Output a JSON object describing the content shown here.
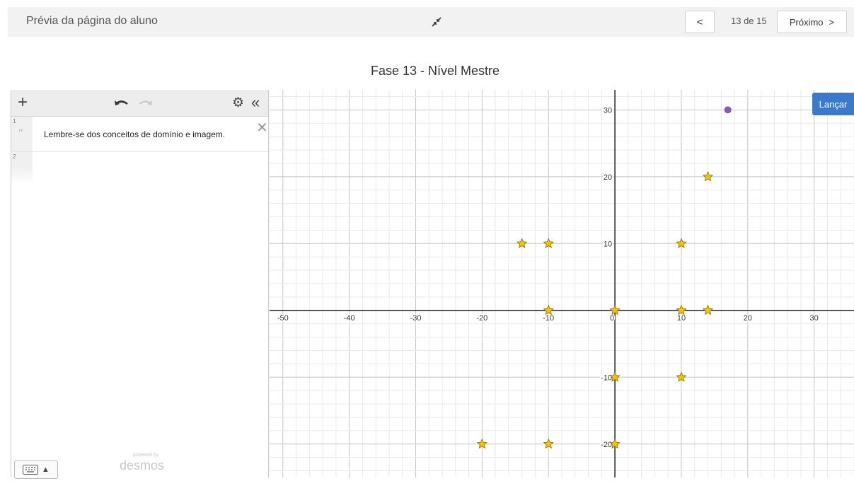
{
  "header": {
    "preview_title": "Prévia da página do aluno",
    "collapse_icon": "collapse-arrows-icon",
    "prev_label": "<",
    "page_counter": "13 de 15",
    "next_label": "Próximo",
    "next_chevron": ">"
  },
  "stage_title": "Fase 13 - Nível Mestre",
  "expressions": {
    "toolbar": {
      "add": "+",
      "settings": "⚙",
      "collapse": "«"
    },
    "rows": [
      {
        "num": "1",
        "quote": "“",
        "text": "Lembre-se dos conceitos de domínio e imagem.",
        "delete": "✕"
      },
      {
        "num": "2"
      }
    ],
    "keyboard_caret": "▲",
    "powered_by": "powered by",
    "logo": "desmos"
  },
  "launch_label": "Lançar",
  "chart_data": {
    "type": "scatter",
    "xlim": [
      -52,
      36
    ],
    "ylim": [
      -25,
      33
    ],
    "x_ticks": [
      -50,
      -40,
      -30,
      -20,
      -10,
      0,
      10,
      20,
      30
    ],
    "x_tick_labels": [
      "-50",
      "-40",
      "-30",
      "-20",
      "-10",
      "0",
      "10",
      "20",
      "30"
    ],
    "y_ticks": [
      30,
      20,
      10,
      -10,
      -20
    ],
    "y_tick_labels": [
      "30",
      "20",
      "10",
      "-10",
      "-20"
    ],
    "grid": true,
    "star_color": "#f4c20d",
    "point_color": "#8b5aa8",
    "stars": [
      {
        "x": -14,
        "y": 10
      },
      {
        "x": -10,
        "y": 10
      },
      {
        "x": 10,
        "y": 10
      },
      {
        "x": 14,
        "y": 20
      },
      {
        "x": -10,
        "y": 0
      },
      {
        "x": 0,
        "y": 0
      },
      {
        "x": 10,
        "y": 0
      },
      {
        "x": 14,
        "y": 0
      },
      {
        "x": 0,
        "y": -10
      },
      {
        "x": 10,
        "y": -10
      },
      {
        "x": -20,
        "y": -20
      },
      {
        "x": -10,
        "y": -20
      },
      {
        "x": 0,
        "y": -20
      }
    ],
    "points": [
      {
        "x": 17,
        "y": 30
      }
    ]
  }
}
